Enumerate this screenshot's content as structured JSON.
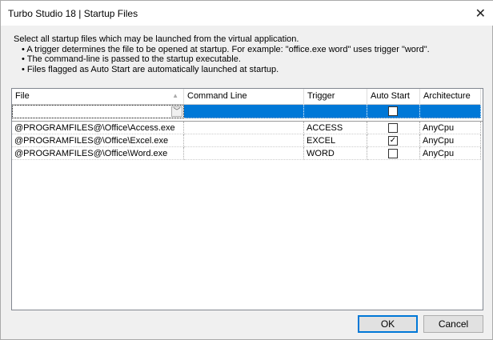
{
  "window": {
    "title": "Turbo Studio 18 | Startup Files"
  },
  "intro": {
    "heading": "Select all startup files which may be launched from the virtual application.",
    "bullets": [
      "A trigger determines the file to be opened at startup.  For example: \"office.exe word\" uses trigger \"word\".",
      "The command-line is passed to the startup executable.",
      "Files flagged as Auto Start are automatically launched at startup."
    ]
  },
  "grid": {
    "columns": [
      "File",
      "Command Line",
      "Trigger",
      "Auto Start",
      "Architecture"
    ],
    "rows": [
      {
        "file": "@PROGRAMFILES@\\Office\\Access.exe",
        "command_line": "",
        "trigger": "ACCESS",
        "auto_start": false,
        "architecture": "AnyCpu"
      },
      {
        "file": "@PROGRAMFILES@\\Office\\Excel.exe",
        "command_line": "",
        "trigger": "EXCEL",
        "auto_start": true,
        "architecture": "AnyCpu"
      },
      {
        "file": "@PROGRAMFILES@\\Office\\Word.exe",
        "command_line": "",
        "trigger": "WORD",
        "auto_start": false,
        "architecture": "AnyCpu"
      }
    ]
  },
  "buttons": {
    "ok": "OK",
    "cancel": "Cancel"
  }
}
